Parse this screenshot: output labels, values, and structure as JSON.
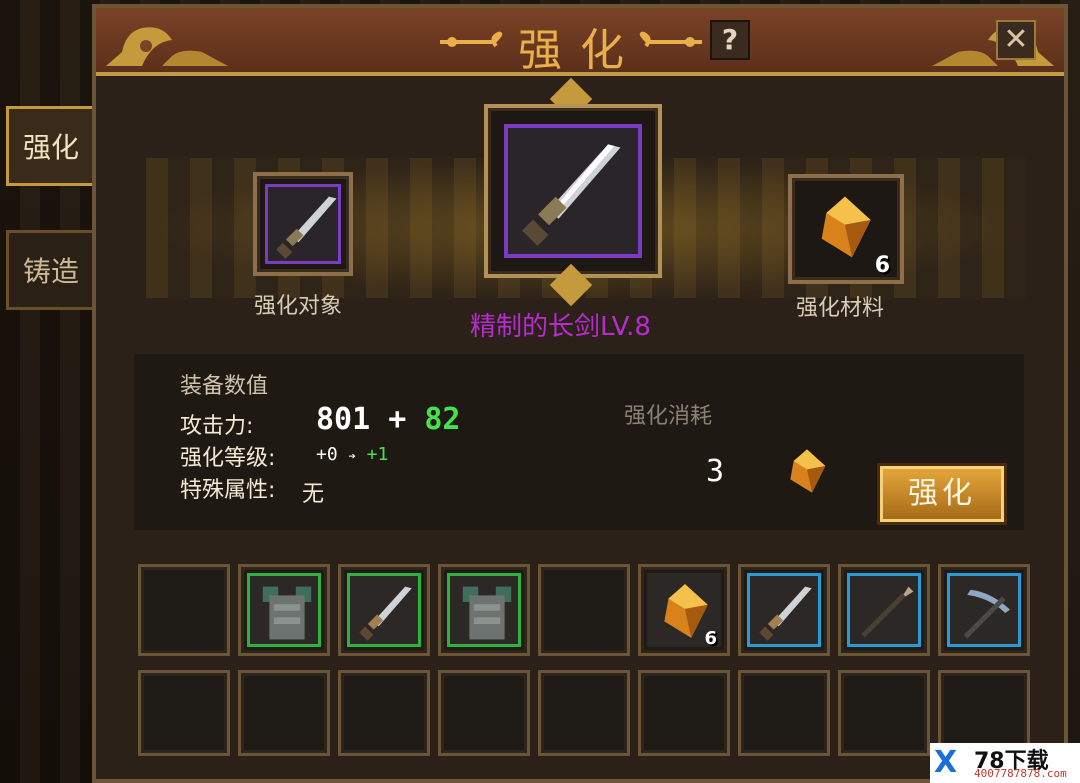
{
  "window": {
    "title": "强化",
    "help_label": "?",
    "close_label": "✕"
  },
  "side_tabs": [
    {
      "label": "强化",
      "active": true
    },
    {
      "label": "铸造",
      "active": false
    }
  ],
  "showcase": {
    "target_label": "强化对象",
    "material_label": "强化材料",
    "material_count": "6",
    "item_name": "精制的长剑LV.8",
    "item_rarity_color": "#b72bd0"
  },
  "stats": {
    "title": "装备数值",
    "attack_label": "攻击力:",
    "attack_base": "801",
    "attack_plus": "+",
    "attack_bonus": "82",
    "level_label": "强化等级:",
    "level_current": "+0",
    "level_arrow": "➔",
    "level_next": "+1",
    "special_label": "特殊属性:",
    "special_value": "无"
  },
  "cost": {
    "title": "强化消耗",
    "amount": "3",
    "icon": "amber-crystal-icon"
  },
  "enhance_button": {
    "label": "强化"
  },
  "inventory": {
    "row1": [
      {
        "item": "",
        "rarity": "",
        "count": ""
      },
      {
        "item": "chestplate-icon",
        "rarity": "green",
        "count": ""
      },
      {
        "item": "sword-icon",
        "rarity": "green",
        "count": ""
      },
      {
        "item": "chestplate-icon",
        "rarity": "green",
        "count": ""
      },
      {
        "item": "",
        "rarity": "",
        "count": ""
      },
      {
        "item": "amber-crystal-icon",
        "rarity": "",
        "count": "6"
      },
      {
        "item": "sword-icon",
        "rarity": "blue",
        "count": ""
      },
      {
        "item": "spear-icon",
        "rarity": "blue",
        "count": ""
      },
      {
        "item": "pickaxe-icon",
        "rarity": "blue",
        "count": ""
      }
    ],
    "row2_count": 9
  },
  "watermark": {
    "logo": "X",
    "title": "78下载",
    "subtitle": "4007787878.com"
  },
  "colors": {
    "gold": "#c49a3c",
    "green_bonus": "#44e34a",
    "rarity_green": "#2eb23c",
    "rarity_blue": "#2a9bd8",
    "rarity_purple": "#7b3cc1"
  }
}
